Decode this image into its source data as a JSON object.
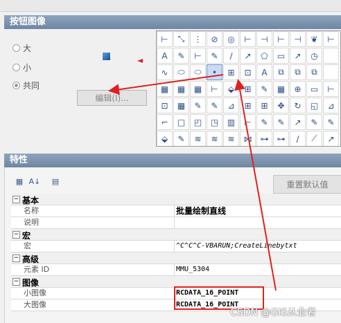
{
  "button_image": {
    "section_title": "按钮图像",
    "radios": [
      {
        "label": "大",
        "checked": false
      },
      {
        "label": "小",
        "checked": false
      },
      {
        "label": "共同",
        "checked": true
      }
    ],
    "edit_button": "编辑(I)..."
  },
  "icons": [
    [
      "⊢",
      "⤡",
      "⋮",
      "⊘",
      "◎",
      "⊢",
      "⊣",
      "⊢",
      "⊣",
      "❦",
      "⊢"
    ],
    [
      "A",
      "✎",
      "⊢",
      "✎",
      "∕",
      "↗",
      "⬠",
      "▭",
      "↗",
      "◷",
      ""
    ],
    [
      "∿",
      "⬭",
      "⬭",
      "•",
      "⊞",
      "⊡",
      "A",
      "⧉",
      "⧉",
      "⧉",
      ""
    ],
    [
      "▦",
      "▦",
      "▦",
      "⊢",
      "⬙",
      "⊞",
      "✎",
      "▦",
      "⊕",
      "▭",
      "⊢"
    ],
    [
      "⊡",
      "▦",
      "✎",
      "✎",
      "⊿",
      "⊞",
      "⊞",
      "✥",
      "↻",
      "◱",
      "⊿"
    ],
    [
      "⌐",
      "□",
      "◰",
      "◳",
      "▥",
      "⊢",
      "✎",
      "✎",
      "↗",
      "✎",
      "✎"
    ],
    [
      "⬙",
      "✎",
      "≋",
      "≋",
      "≋",
      "⋈",
      "⊶",
      "⊶",
      "∕",
      "⟋",
      "↗"
    ]
  ],
  "properties": {
    "section_title": "特性",
    "reset_button": "重置默认值",
    "groups": [
      {
        "title": "基本",
        "rows": [
          {
            "key": "名称",
            "value": "批量绘制直线"
          },
          {
            "key": "说明",
            "value": ""
          }
        ]
      },
      {
        "title": "宏",
        "rows": [
          {
            "key": "宏",
            "value": "^C^C^C-VBARUN;CreateLinebytxt"
          }
        ]
      },
      {
        "title": "高级",
        "rows": [
          {
            "key": "元素 ID",
            "value": "MMU_5304"
          }
        ]
      },
      {
        "title": "图像",
        "rows": [
          {
            "key": "小图像",
            "value": "RCDATA_16_POINT"
          },
          {
            "key": "大图像",
            "value": "RCDATA_16_POINT"
          }
        ]
      }
    ]
  },
  "watermark": "CSDN @GIS从业者",
  "colors": {
    "annotation": "#e02020",
    "header": "#7b90ac"
  }
}
